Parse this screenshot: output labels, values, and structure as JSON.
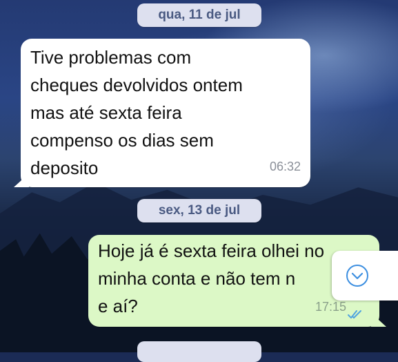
{
  "chat": {
    "dates": [
      "qua, 11 de jul",
      "sex, 13 de jul",
      "..."
    ],
    "messages": [
      {
        "direction": "incoming",
        "text": "Tive problemas com\ncheques devolvidos ontem\nmas até sexta feira\ncompenso os dias sem\ndeposito",
        "time": "06:32"
      },
      {
        "direction": "outgoing",
        "text": "Hoje já é sexta feira olhei no\nminha conta e não tem n\ne aí?",
        "time": "17:15",
        "status": "read"
      }
    ]
  },
  "icons": {
    "read_receipt": "double-check-icon",
    "scroll_down": "chevron-down-circle-icon"
  },
  "colors": {
    "incoming_bubble": "#ffffff",
    "outgoing_bubble": "#dcf8c6",
    "date_pill": "#dde0ef",
    "read_ticks": "#4fa3e0",
    "scroll_icon": "#3b8ee0"
  }
}
